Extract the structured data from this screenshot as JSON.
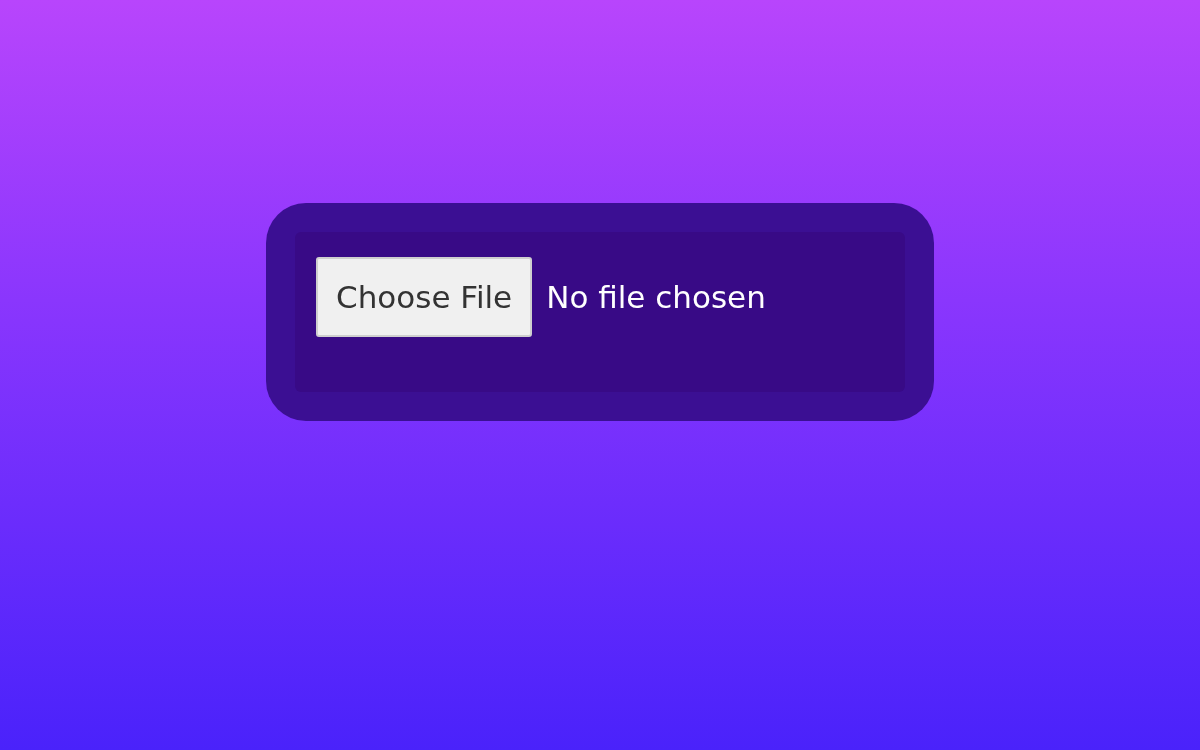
{
  "file_input": {
    "button": "Choose File",
    "status": "No file chosen"
  }
}
